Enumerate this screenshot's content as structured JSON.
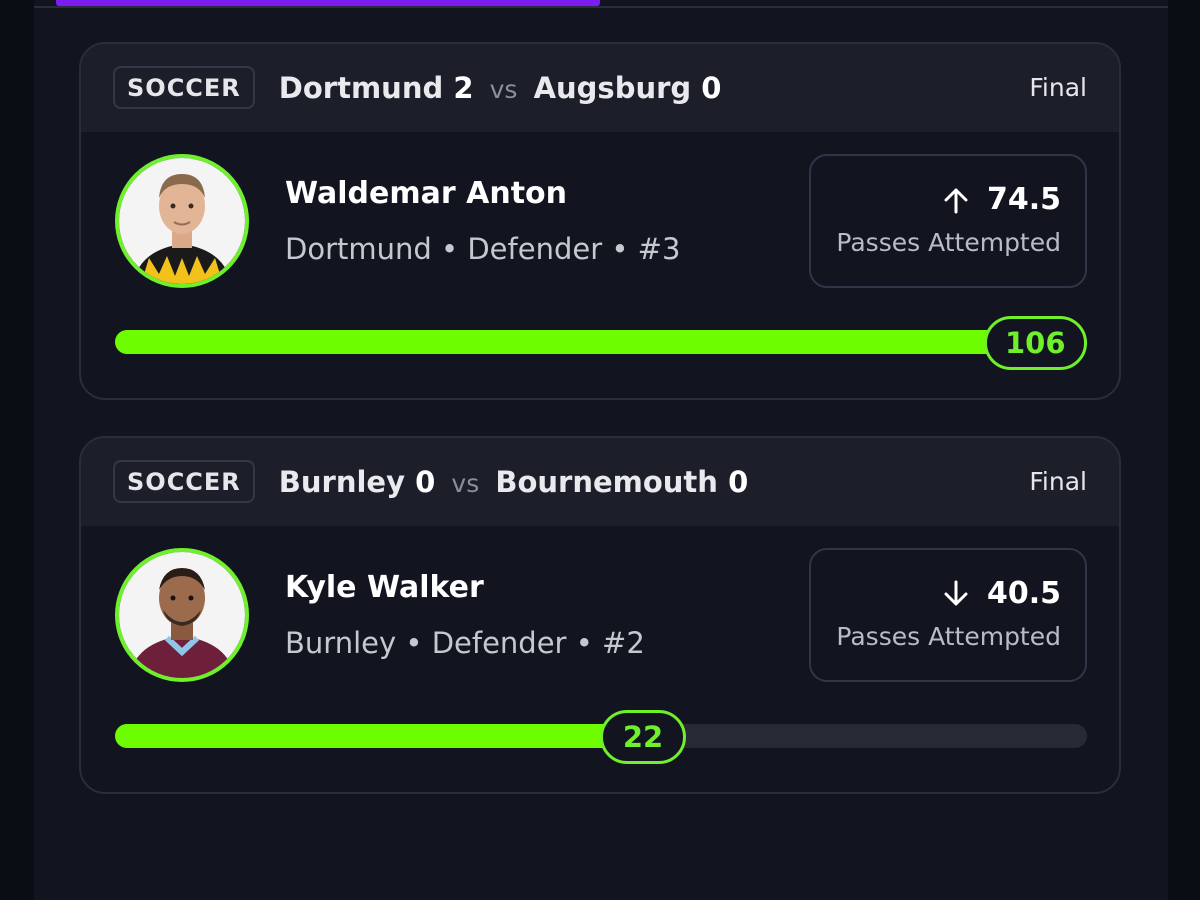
{
  "colors": {
    "accent_green": "#6efc00",
    "progress_purple": "#7b1cf0",
    "background": "#12141f"
  },
  "cards": [
    {
      "sport": "SOCCER",
      "home_team": "Dortmund",
      "home_score": "2",
      "vs": "vs",
      "away_team": "Augsburg",
      "away_score": "0",
      "status": "Final",
      "player_name": "Waldemar Anton",
      "team": "Dortmund",
      "position": "Defender",
      "number": "#3",
      "separator": "•",
      "direction_icon": "arrow-up-icon",
      "line": "74.5",
      "stat": "Passes Attempted",
      "result": "106",
      "progress_fraction": 1.0
    },
    {
      "sport": "SOCCER",
      "home_team": "Burnley",
      "home_score": "0",
      "vs": "vs",
      "away_team": "Bournemouth",
      "away_score": "0",
      "status": "Final",
      "player_name": "Kyle Walker",
      "team": "Burnley",
      "position": "Defender",
      "number": "#2",
      "separator": "•",
      "direction_icon": "arrow-down-icon",
      "line": "40.5",
      "stat": "Passes Attempted",
      "result": "22",
      "progress_fraction": 0.543
    }
  ]
}
